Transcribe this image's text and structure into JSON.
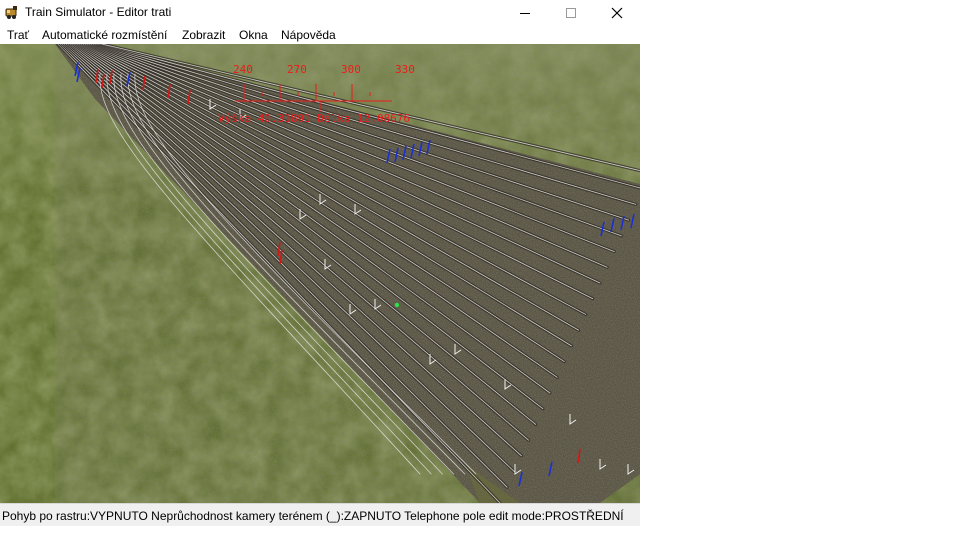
{
  "window": {
    "title": "Train Simulator - Editor trati",
    "controls": {
      "minimize": "minimize-icon",
      "maximize": "maximize-icon",
      "close": "close-icon"
    }
  },
  "menu": {
    "items": [
      {
        "label": "Trať"
      },
      {
        "label": "Automatické rozmístění"
      },
      {
        "label": "Zobrazit"
      },
      {
        "label": "Okna"
      },
      {
        "label": "Nápověda"
      }
    ]
  },
  "viewport": {
    "compass": {
      "ticks": [
        "240",
        "270",
        "300",
        "330"
      ],
      "readout": "Výška 40.31891 Délka 12.08676"
    },
    "colors": {
      "grass": "#5d6a2f",
      "rails": "#e8e8e8",
      "ruler": "#ee1b1b",
      "markers_blue": "#1a2fd6",
      "markers_red": "#d01818"
    }
  },
  "status": {
    "text": "Pohyb po rastru:VYPNUTO Neprůchodnost kamery terénem (_):ZAPNUTO Telephone pole edit mode:PROSTŘEDNÍ"
  }
}
